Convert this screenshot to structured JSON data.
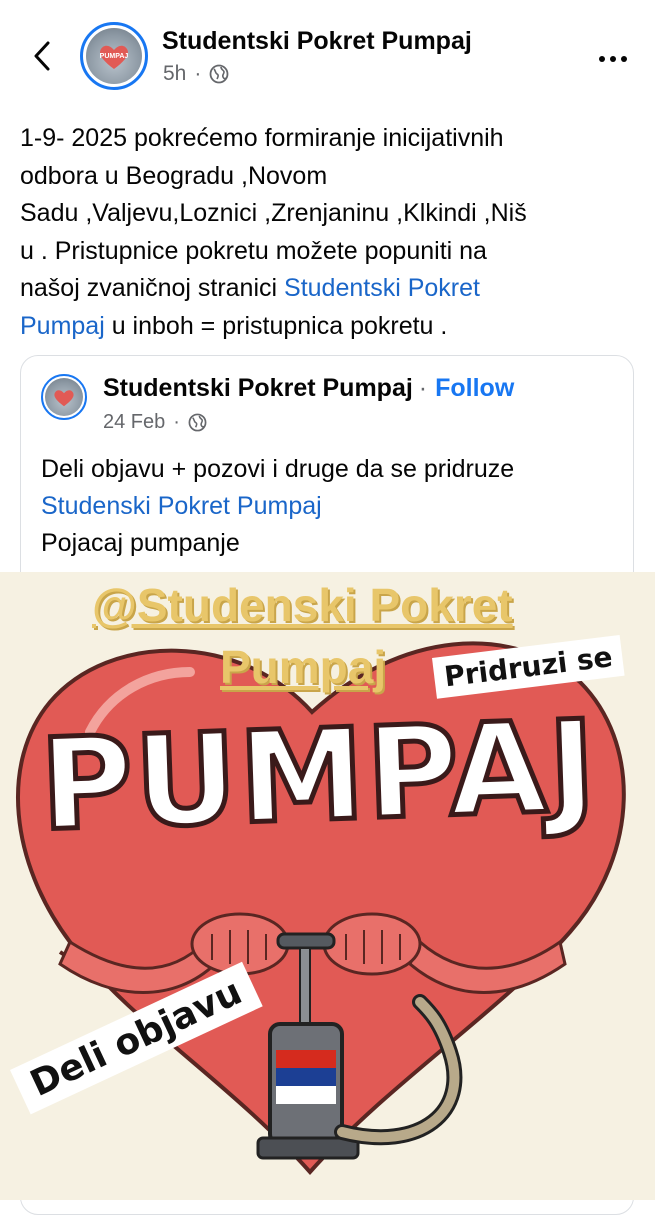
{
  "header": {
    "page_name": "Studentski Pokret Pumpaj",
    "time": "5h",
    "separator": "·",
    "back_icon": "chevron-left-icon",
    "privacy_icon": "globe-icon",
    "more_icon": "more-dots-icon"
  },
  "post": {
    "lines": [
      "1-9- 2025 pokrećemo formiranje inicijativnih",
      "odbora u Beogradu ,Novom",
      "Sadu ,Valjevu,Loznici ,Zrenjaninu ,Klkindi ,Niš",
      "u . Pristupnice pokretu možete popuniti na"
    ],
    "line5_prefix": "našoj zvaničnoj stranici ",
    "link_part1": "Studentski Pokret",
    "link_part2": "Pumpaj",
    "line6_suffix": " u inboh = pristupnica pokretu ."
  },
  "shared": {
    "page_name": "Studentski Pokret Pumpaj",
    "separator": "·",
    "follow_label": "Follow",
    "date": "24 Feb",
    "separator2": "·",
    "text_line1": "Deli objavu + pozovi i druge da se pridruze",
    "text_link": "Studenski Pokret Pumpaj",
    "text_line3": "Pojacaj pumpanje"
  },
  "image": {
    "handle_line1": "@Studenski Pokret",
    "handle_line2": "Pumpaj",
    "join_sticker": "Pridruzi se",
    "big_word": "PUMPAJ",
    "share_sticker": "Deli objavu",
    "avatar_word": "PUMPAJ"
  },
  "colors": {
    "link": "#1a66c9",
    "follow": "#1877f2",
    "heart": "#e15a55",
    "flag_red": "#d52b1e",
    "flag_blue": "#1c3f94",
    "flag_white": "#ffffff"
  }
}
